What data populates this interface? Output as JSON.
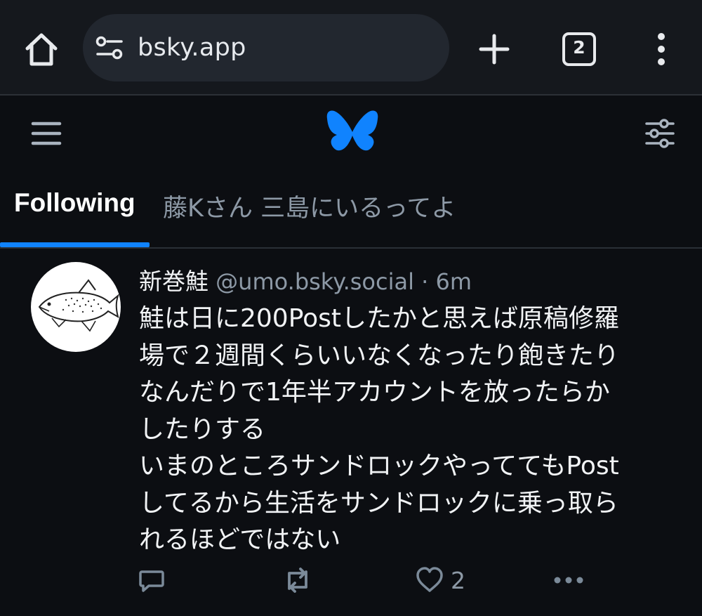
{
  "browser": {
    "url": "bsky.app",
    "tab_count": "2",
    "icons": [
      "home-icon",
      "site-settings-icon",
      "new-tab-icon",
      "tab-switcher-icon",
      "more-menu-icon"
    ]
  },
  "header": {
    "icons": [
      "hamburger-menu-icon",
      "butterfly-logo-icon",
      "feed-settings-icon"
    ],
    "logo_color": "#1083fe"
  },
  "tabs": [
    {
      "label": "Following",
      "active": true
    },
    {
      "label": "藤Kさん 三島にいるってよ",
      "active": false
    }
  ],
  "post": {
    "author_name": "新巻鮭",
    "handle": "@umo.bsky.social",
    "separator": "·",
    "time": "6m",
    "text": "鮭は日に200Postしたかと思えば原稿修羅\n場で２週間くらいいなくなったり飽きたり\nなんだりで1年半アカウントを放ったらか\nしたりする\nいまのところサンドロックやっててもPost\nしてるから生活をサンドロックに乗っ取ら\nれるほどではない",
    "like_count": "2"
  },
  "colors": {
    "accent": "#1083fe",
    "background": "#0c0e12",
    "chrome": "#15181d",
    "muted_text": "#8d99a6",
    "action_icon": "#7b8a99"
  }
}
